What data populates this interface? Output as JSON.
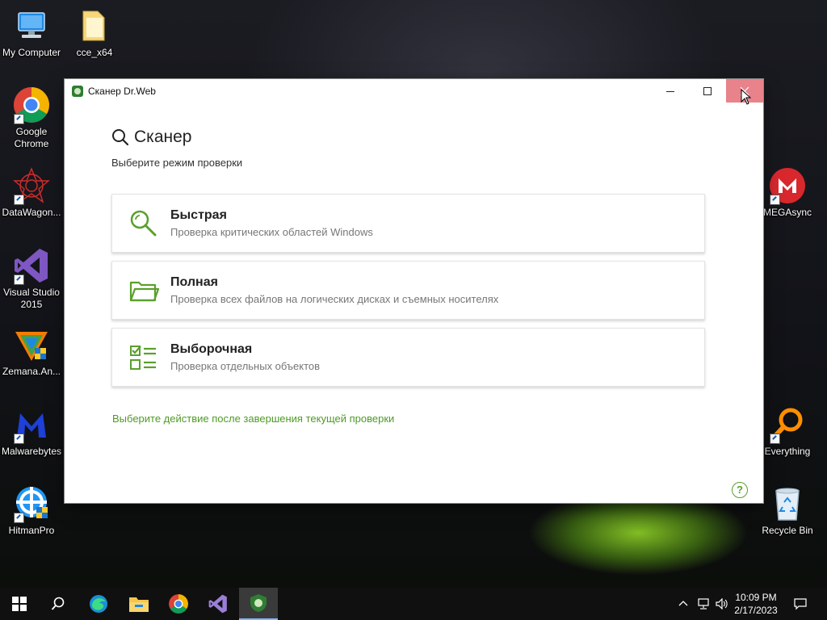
{
  "desktop": {
    "icons": [
      {
        "label": "My Computer"
      },
      {
        "label": "cce_x64"
      },
      {
        "label": "Google Chrome"
      },
      {
        "label": "DataWagon..."
      },
      {
        "label": "Visual Studio 2015"
      },
      {
        "label": "Zemana.An..."
      },
      {
        "label": "Malwarebytes"
      },
      {
        "label": "HitmanPro"
      },
      {
        "label": "MEGAsync"
      },
      {
        "label": "Everything"
      },
      {
        "label": "Recycle Bin"
      }
    ]
  },
  "window": {
    "title": "Сканер Dr.Web",
    "heading": "Сканер",
    "subtitle": "Выберите режим проверки",
    "modes": [
      {
        "title": "Быстрая",
        "description": "Проверка критических областей Windows",
        "icon": "magnifier-icon"
      },
      {
        "title": "Полная",
        "description": "Проверка всех файлов на логических дисках и съемных носителях",
        "icon": "folder-icon"
      },
      {
        "title": "Выборочная",
        "description": "Проверка отдельных объектов",
        "icon": "checklist-icon"
      }
    ],
    "after_scan_link": "Выберите действие после завершения текущей проверки",
    "help_glyph": "?"
  },
  "taskbar": {
    "time": "10:09 PM",
    "date": "2/17/2023"
  },
  "colors": {
    "accent_green": "#5aa02c",
    "close_hover": "#e8838b"
  }
}
